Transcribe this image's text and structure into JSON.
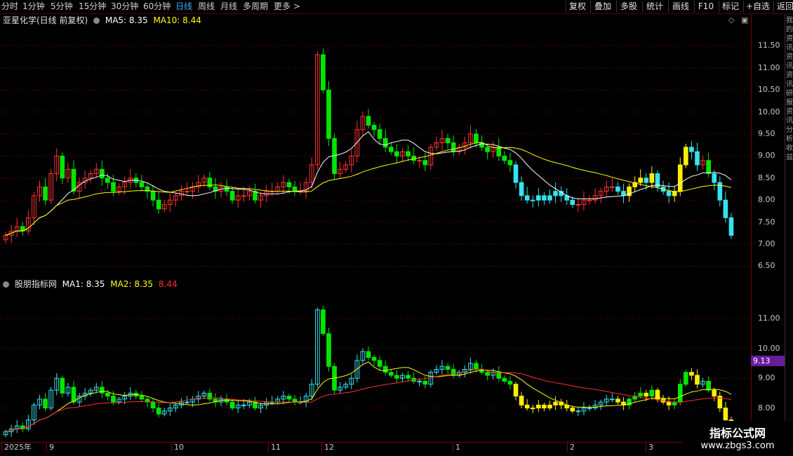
{
  "toolbar": {
    "periods": [
      "分时",
      "1分钟",
      "5分钟",
      "15分钟",
      "30分钟",
      "60分钟",
      "日线",
      "周线",
      "月线",
      "多周期",
      "更多"
    ],
    "active_period": "日线",
    "more_glyph": ">",
    "right_buttons": [
      "复权",
      "叠加",
      "多股",
      "统计",
      "画线",
      "F10",
      "标记",
      "+自选",
      "返回"
    ]
  },
  "main_panel": {
    "title": "亚星化学(日线 前复权)",
    "ma5": "MA5: 8.35",
    "ma10": "MA10: 8.44",
    "ma5_color": "#ffffff",
    "ma10_color": "#ffff00",
    "y_ticks": [
      "11.50",
      "11.00",
      "10.50",
      "10.00",
      "9.50",
      "9.00",
      "8.50",
      "8.00",
      "7.50",
      "7.00",
      "6.50"
    ],
    "icons": [
      "diamond-icon",
      "window-icon"
    ]
  },
  "sub_panel": {
    "title": "股朋指标网",
    "ma1": "MA1: 8.35",
    "ma2": "MA2: 8.35",
    "ma3": "8.44",
    "ma1_color": "#ffffff",
    "ma2_color": "#ffff00",
    "ma3_color": "#ff3030",
    "y_ticks": [
      "11.00",
      "10.00",
      "9.00",
      "8.00"
    ],
    "cursor_value": "9.13"
  },
  "date_axis": [
    "2025年",
    "9",
    "10",
    "11",
    "12",
    "1",
    "2",
    "3"
  ],
  "side_strip": [
    "我",
    "的",
    "资",
    "讯",
    "资",
    "讯",
    "资",
    "讯",
    "研",
    "报",
    "资",
    "讯",
    "分",
    "析",
    "收",
    "益"
  ],
  "watermark": {
    "line1": "指标公式网",
    "line2": "www.zbgs3.com"
  },
  "colors": {
    "up": "#ff3232",
    "down": "#00e600",
    "cyan": "#35e2ee",
    "yellow": "#ffee00",
    "grid": "#5a0000"
  },
  "chart_data": {
    "type": "candlestick",
    "x": [
      "2025-08",
      "2025-09",
      "2025-10",
      "2025-11",
      "2025-12",
      "2026-01",
      "2026-02",
      "2026-03"
    ],
    "y_range_main": [
      6.3,
      12.0
    ],
    "y_range_sub": [
      7.0,
      12.0
    ],
    "close_series": [
      7.2,
      7.3,
      7.4,
      7.3,
      7.6,
      8.1,
      8.3,
      8.0,
      8.6,
      9.0,
      8.5,
      8.7,
      8.2,
      8.4,
      8.5,
      8.6,
      8.7,
      8.5,
      8.4,
      8.2,
      8.3,
      8.4,
      8.5,
      8.4,
      8.3,
      8.2,
      8.0,
      7.8,
      7.9,
      8.0,
      8.1,
      8.2,
      8.2,
      8.3,
      8.4,
      8.5,
      8.3,
      8.2,
      8.3,
      8.2,
      8.0,
      8.1,
      8.1,
      8.2,
      8.0,
      8.1,
      8.2,
      8.2,
      8.3,
      8.4,
      8.3,
      8.2,
      8.2,
      8.4,
      8.8,
      11.3,
      10.5,
      9.4,
      8.6,
      8.7,
      8.8,
      9.0,
      9.6,
      9.9,
      9.7,
      9.6,
      9.4,
      9.2,
      9.1,
      9.0,
      9.1,
      9.0,
      8.9,
      8.9,
      8.8,
      9.2,
      9.3,
      9.4,
      9.3,
      9.1,
      9.2,
      9.3,
      9.5,
      9.3,
      9.2,
      9.1,
      9.2,
      9.0,
      8.9,
      8.8,
      8.4,
      8.1,
      8.0,
      8.0,
      8.1,
      8.0,
      8.1,
      8.2,
      8.1,
      8.0,
      7.9,
      7.9,
      8.0,
      8.0,
      8.1,
      8.2,
      8.3,
      8.3,
      8.2,
      8.1,
      8.3,
      8.4,
      8.5,
      8.4,
      8.6,
      8.3,
      8.2,
      8.1,
      8.2,
      8.8,
      9.2,
      9.1,
      8.8,
      8.9,
      8.6,
      8.4,
      8.0,
      7.6,
      7.2
    ]
  }
}
